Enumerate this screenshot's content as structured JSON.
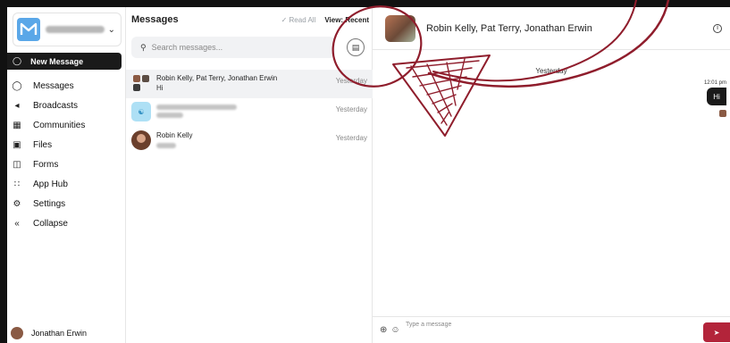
{
  "sidebar": {
    "new_message": "New Message",
    "items": [
      {
        "label": "Messages",
        "icon": "chat-bubble-icon"
      },
      {
        "label": "Broadcasts",
        "icon": "megaphone-icon"
      },
      {
        "label": "Communities",
        "icon": "community-grid-icon"
      },
      {
        "label": "Files",
        "icon": "folder-icon"
      },
      {
        "label": "Forms",
        "icon": "form-icon"
      },
      {
        "label": "App Hub",
        "icon": "app-hub-icon"
      },
      {
        "label": "Settings",
        "icon": "gear-icon"
      },
      {
        "label": "Collapse",
        "icon": "double-chevron-left-icon"
      }
    ],
    "user_name": "Jonathan Erwin"
  },
  "list": {
    "title": "Messages",
    "read_all": "Read All",
    "view_label": "View:",
    "view_value": "Recent",
    "search_placeholder": "Search messages...",
    "conversations": [
      {
        "name": "Robin Kelly, Pat Terry, Jonathan Erwin",
        "preview": "Hi",
        "time": "Yesterday",
        "active": true
      },
      {
        "name": "",
        "preview": "",
        "time": "Yesterday",
        "active": false
      },
      {
        "name": "Robin Kelly",
        "preview": "",
        "time": "Yesterday",
        "active": false
      }
    ]
  },
  "chat": {
    "title": "Robin Kelly, Pat Terry, Jonathan Erwin",
    "day_label": "Yesterday",
    "message_time": "12:01 pm",
    "message_text": "Hi",
    "composer_placeholder": "Type a message"
  },
  "colors": {
    "accent": "#b3243a",
    "dark": "#1a1a1a",
    "annotation": "#8f1d2c"
  }
}
